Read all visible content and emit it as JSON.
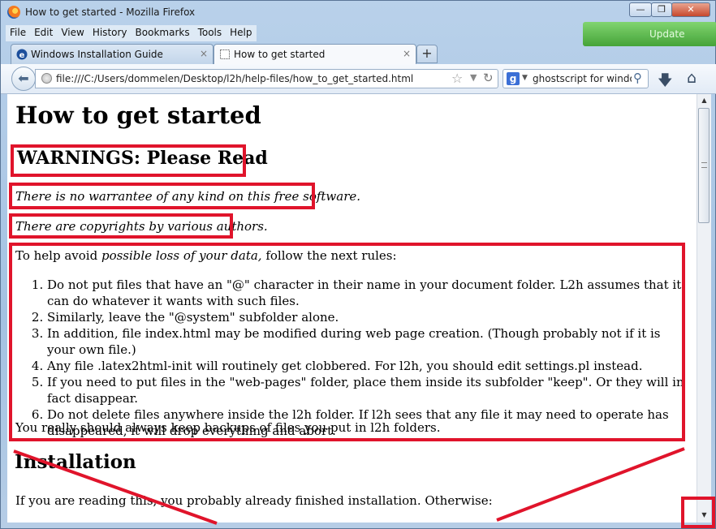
{
  "window": {
    "title": "How to get started - Mozilla Firefox",
    "minimize_label": "—",
    "maximize_label": "❐",
    "close_label": "✕",
    "external_button_label": "Update"
  },
  "menubar": [
    "File",
    "Edit",
    "View",
    "History",
    "Bookmarks",
    "Tools",
    "Help"
  ],
  "tabs": [
    {
      "label": "Windows Installation Guide",
      "active": false
    },
    {
      "label": "How to get started",
      "active": true
    }
  ],
  "tab_close_symbol": "×",
  "new_tab_symbol": "+",
  "navbar": {
    "back_symbol": "⬅",
    "url": "file:///C:/Users/dommelen/Desktop/l2h/help-files/how_to_get_started.html",
    "search_engine_letter": "g",
    "search_query": "ghostscript for windows"
  },
  "page": {
    "title": "How to get started",
    "warnings_heading": "WARNINGS: Please Read",
    "warranty_text": "There is no warrantee of any kind on this free software.",
    "copyright_text": "There are copyrights by various authors.",
    "intro_prefix": "To help avoid ",
    "intro_emphasis": "possible loss of your data,",
    "intro_suffix": " follow the next rules:",
    "rules": [
      "Do not put files that have an \"@\" character in their name in your document folder. L2h assumes that it can do whatever it wants with such files.",
      "Similarly, leave the \"@system\" subfolder alone.",
      "In addition, file index.html may be modified during web page creation. (Though probably not if it is your own file.)",
      "Any file .latex2html-init will routinely get clobbered. For l2h, you should edit settings.pl instead.",
      "If you need to put files in the \"web-pages\" folder, place them inside its subfolder \"keep\". Or they will in fact disappear.",
      "Do not delete files anywhere inside the l2h folder. If l2h sees that any file it may need to operate has disappeared, it will drop everything and abort."
    ],
    "backup_text": "You really should always keep backups of files you put in l2h folders.",
    "installation_heading": "Installation",
    "installation_text": "If you are reading this, you probably already finished installation. Otherwise:"
  },
  "colors": {
    "annotation_red": "#e0142b",
    "chrome_blue": "#a9c4e4"
  }
}
